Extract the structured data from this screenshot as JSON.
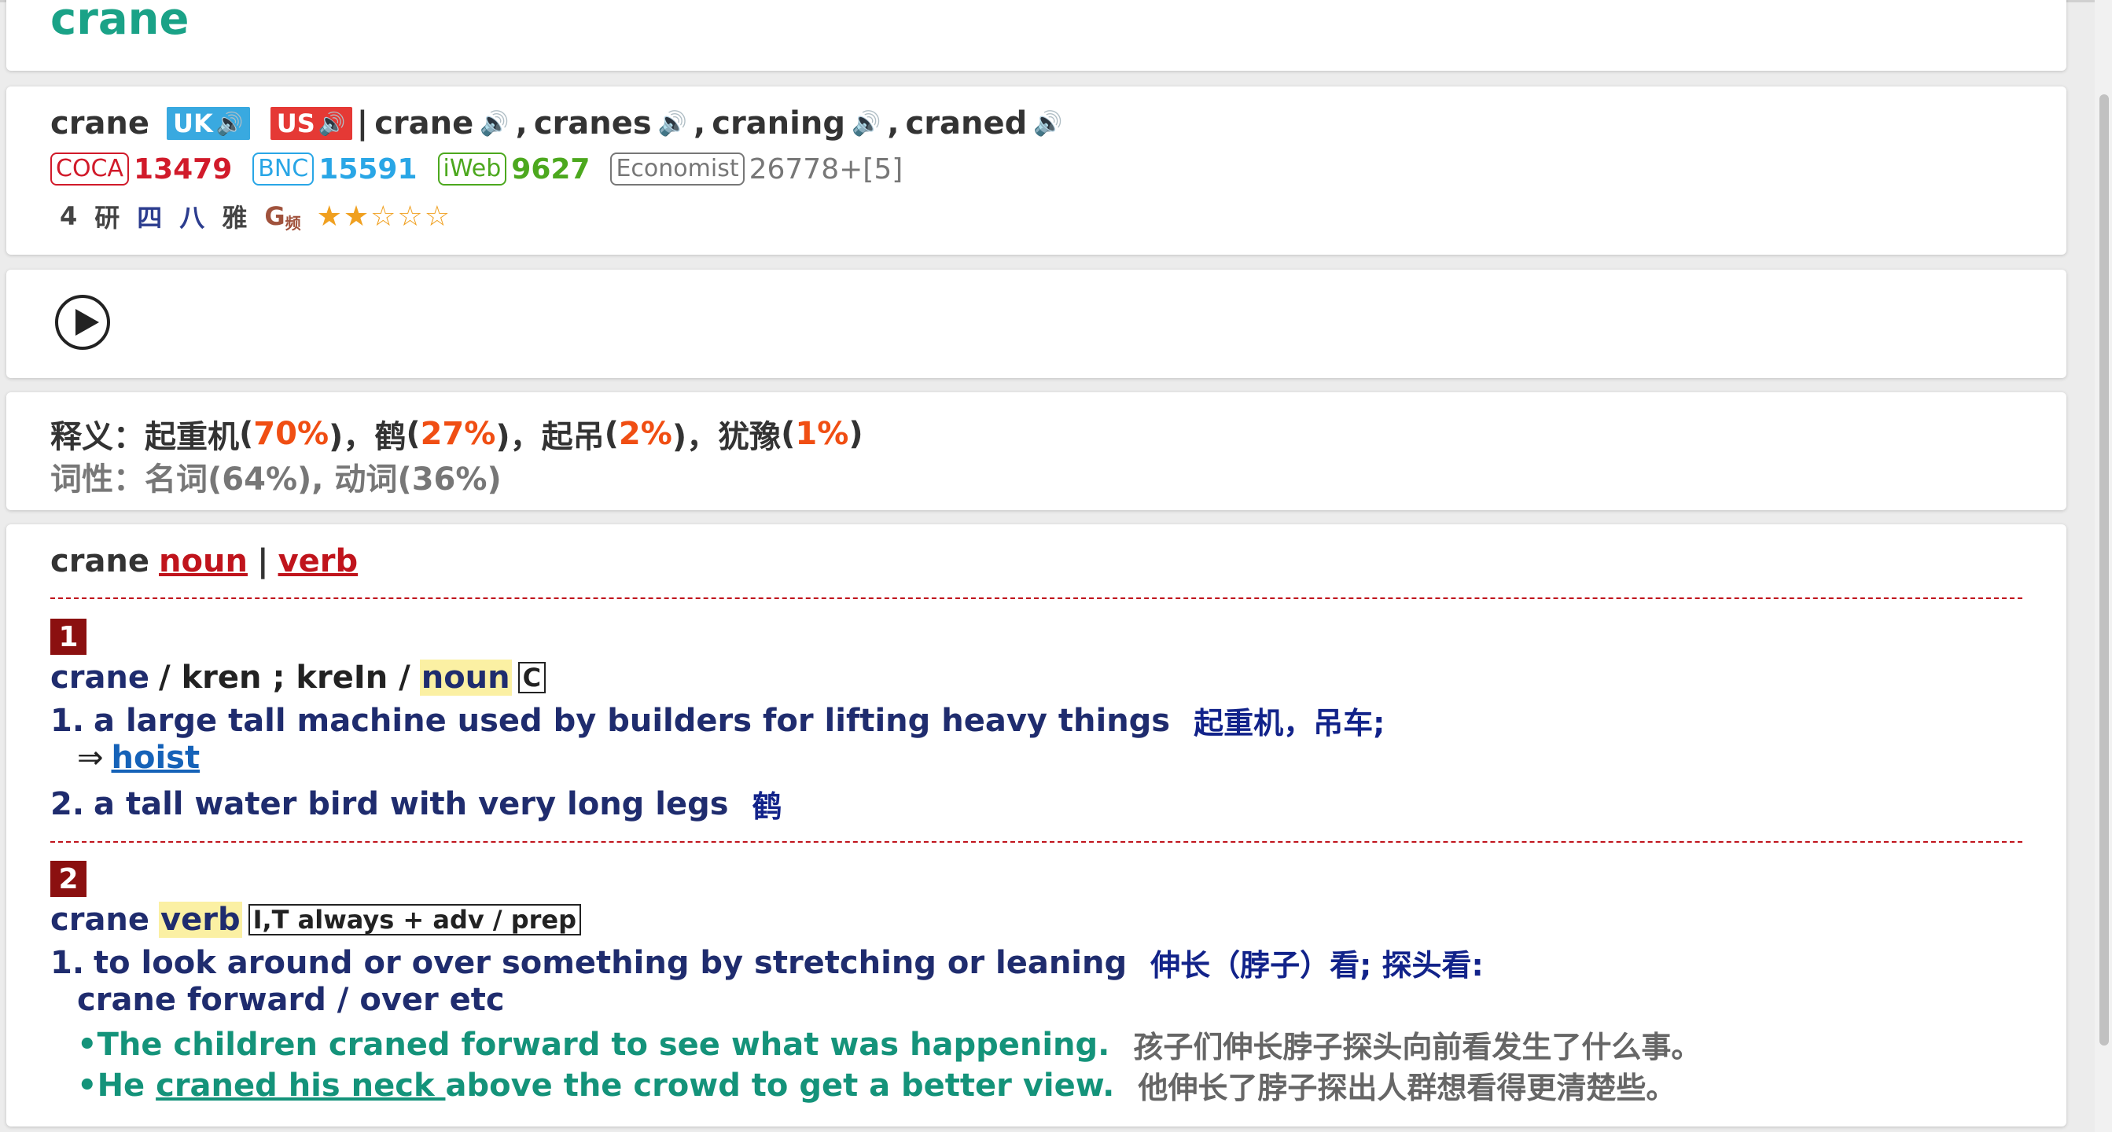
{
  "headword": "crane",
  "forms": {
    "base": "crane",
    "uk_label": "UK",
    "us_label": "US",
    "separator": "|",
    "inflections": [
      "crane",
      "cranes",
      "craning",
      "craned"
    ],
    "comma": ","
  },
  "ranks": [
    {
      "source": "COCA",
      "value": "13479"
    },
    {
      "source": "BNC",
      "value": "15591"
    },
    {
      "source": "iWeb",
      "value": "9627"
    },
    {
      "source": "Economist",
      "value": "26778+[5]"
    }
  ],
  "tags": [
    "4",
    "研",
    "四",
    "八",
    "雅",
    "G"
  ],
  "tag_g_sub": "频",
  "stars_text": "★★☆☆☆",
  "rating": {
    "filled": 2,
    "total": 5
  },
  "meaning": {
    "label": "释义：",
    "items": [
      {
        "zh": "起重机",
        "pct": "70%"
      },
      {
        "zh": "鹤",
        "pct": "27%"
      },
      {
        "zh": "起吊",
        "pct": "2%"
      },
      {
        "zh": "犹豫",
        "pct": "1%"
      }
    ],
    "pos_label": "词性：",
    "pos_text": "名词(64%), 动词(36%)"
  },
  "entry_nav": {
    "word": "crane",
    "noun": "noun",
    "divider": "|",
    "verb": "verb"
  },
  "entries": [
    {
      "number": "1",
      "word": "crane",
      "pron": "/ kren ; kreIn /",
      "pos": "noun",
      "grammar": "C",
      "senses": [
        {
          "num": "1.",
          "en": "a large tall machine used by builders for lifting heavy things",
          "zh": "起重机，吊车;"
        },
        {
          "num": "2.",
          "en": "a tall water bird with very long legs",
          "zh": "鹤"
        }
      ],
      "xref_arrow": "⇒",
      "xref": "hoist"
    },
    {
      "number": "2",
      "word": "crane",
      "pos": "verb",
      "grammar": "I,T always + adv / prep",
      "senses": [
        {
          "num": "1.",
          "en": "to look around or over something by stretching or leaning",
          "zh": "伸长（脖子）看; 探头看:"
        }
      ],
      "phrase": "crane forward / over etc",
      "examples": [
        {
          "bullet": "•",
          "en": "The children craned forward to see what was happening.",
          "zh": "孩子们伸长脖子探头向前看发生了什么事。"
        },
        {
          "bullet": "•",
          "pre": "He ",
          "u": "craned his neck ",
          "post": "above the crowd to get a better view.",
          "zh": "他伸长了脖子探出人群想看得更清楚些。"
        }
      ]
    }
  ],
  "colors": {
    "headword": "#1aa287",
    "uk": "#39a9e0",
    "us": "#e53935",
    "coca": "#d11a2a",
    "bnc": "#29a6e6",
    "iweb": "#4ca81e",
    "economist": "#777777",
    "percent": "#f04e13",
    "entry_number": "#8b1010",
    "definition": "#1f2c6e",
    "example": "#14937a"
  },
  "icons": {
    "speaker": "speaker-icon",
    "play": "play-icon"
  }
}
